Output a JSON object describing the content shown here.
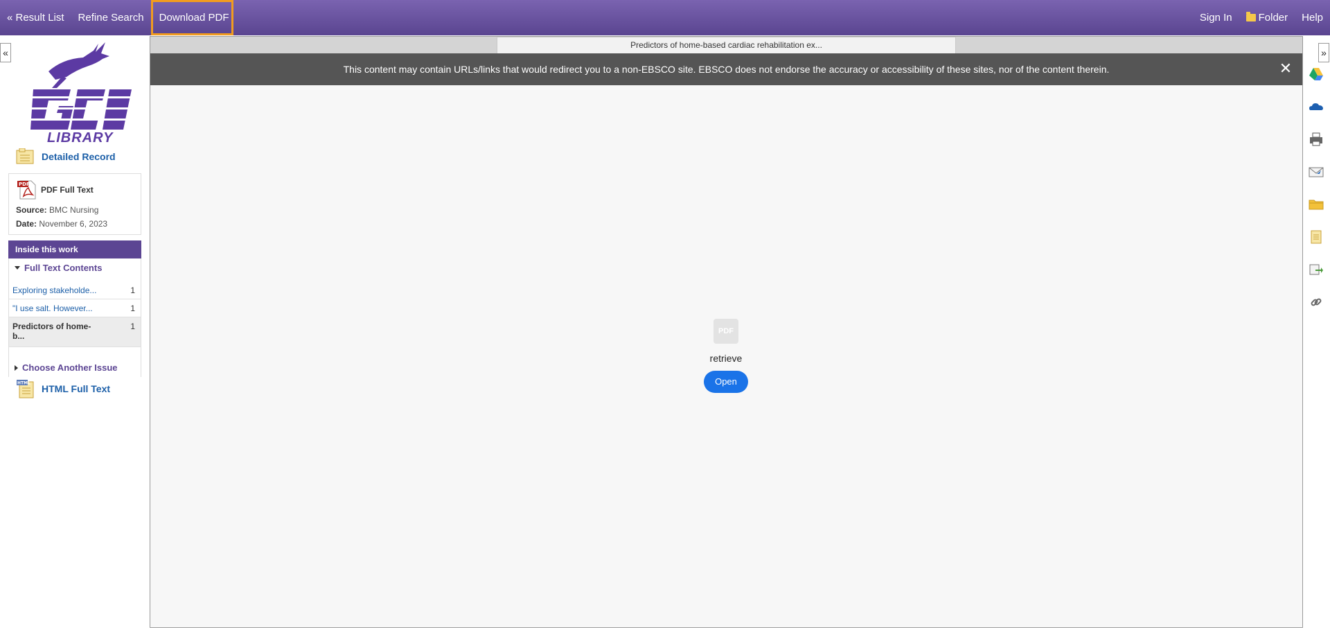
{
  "topbar": {
    "result_list": "« Result List",
    "refine_search": "Refine Search",
    "download_pdf": "Download PDF",
    "sign_in": "Sign In",
    "folder": "Folder",
    "help": "Help"
  },
  "toggles": {
    "left": "«",
    "right": "»"
  },
  "sidebar": {
    "logo_text": "GCU",
    "logo_sub": "LIBRARY",
    "detailed_record": "Detailed Record",
    "pdf_full_text": "PDF Full Text",
    "pdf_icon_text": "PDF",
    "source_label": "Source:",
    "source_value": "BMC Nursing",
    "date_label": "Date:",
    "date_value": "November 6, 2023",
    "inside_this_work": "Inside this work",
    "full_text_contents": "Full Text Contents",
    "toc": [
      {
        "title": "Exploring stakeholde...",
        "page": "1"
      },
      {
        "title": "\"I use salt. However...",
        "page": "1"
      },
      {
        "title": "Predictors of home-b...",
        "page": "1"
      }
    ],
    "choose_another_issue": "Choose Another Issue",
    "html_full_text": "HTML Full Text",
    "html_icon_text": "HTML"
  },
  "viewer": {
    "tab_title": "Predictors of home-based cardiac rehabilitation ex...",
    "notice": "This content may contain URLs/links that would redirect you to a non-EBSCO site. EBSCO does not endorse the accuracy or accessibility of these sites, nor of the content therein.",
    "close": "✕",
    "pdf_tile": "PDF",
    "retrieve": "retrieve",
    "open": "Open"
  },
  "colors": {
    "topbar": "#6a54a0",
    "highlight": "#f29c1f",
    "accent_purple": "#5c4593",
    "link_blue": "#1c5fa8",
    "button_blue": "#1a73e8"
  },
  "tools": [
    "google-drive-icon",
    "onedrive-icon",
    "print-icon",
    "email-icon",
    "save-folder-icon",
    "cite-icon",
    "export-icon",
    "permalink-icon"
  ]
}
